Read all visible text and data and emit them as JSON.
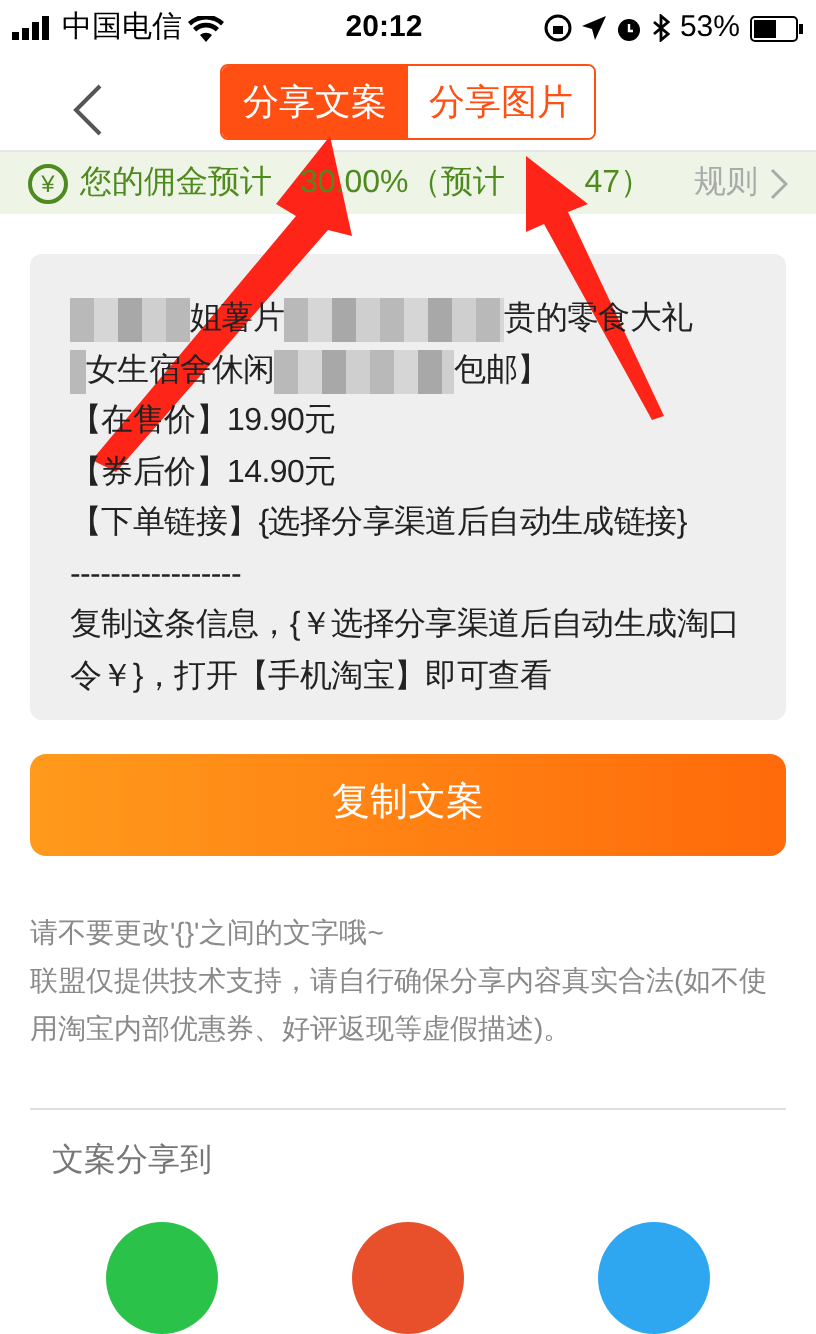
{
  "status_bar": {
    "carrier": "中国电信",
    "time": "20:12",
    "battery": "53%"
  },
  "tabs": [
    {
      "label": "分享文案",
      "selected": true
    },
    {
      "label": "分享图片",
      "selected": false
    }
  ],
  "commission": {
    "icon": "¥",
    "parts": [
      "您的佣金预计",
      "30.00%（预计",
      "47）"
    ],
    "rules_link": "规则"
  },
  "share_text": {
    "blurred_lines": [
      [
        "姐薯片",
        "贵的零食大礼"
      ],
      [
        "女生宿舍休闲",
        "包邮】"
      ]
    ],
    "lines": [
      "【在售价】19.90元",
      "【券后价】14.90元",
      "【下单链接】{选择分享渠道后自动生成链接}",
      "-----------------",
      "复制这条信息，{￥选择分享渠道后自动生成淘口令￥}，打开【手机淘宝】即可查看"
    ]
  },
  "copy_button": "复制文案",
  "notes": [
    "请不要更改'{}'之间的文字哦~",
    "联盟仅提供技术支持，请自行确保分享内容真实合法(如不使用淘宝内部优惠券、好评返现等虚假描述)。"
  ],
  "share_to": {
    "label": "文案分享到",
    "targets": [
      {
        "color": "#2bc24a"
      },
      {
        "color": "#e8502c"
      },
      {
        "color": "#2ea7f0"
      }
    ]
  }
}
